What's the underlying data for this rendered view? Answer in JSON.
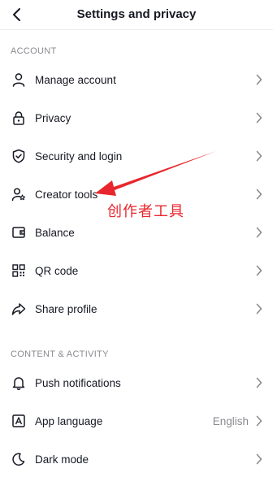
{
  "header": {
    "title": "Settings and privacy"
  },
  "sections": {
    "account": "ACCOUNT",
    "content": "CONTENT & ACTIVITY"
  },
  "items": {
    "manage_account": "Manage account",
    "privacy": "Privacy",
    "security": "Security and login",
    "creator_tools": "Creator tools",
    "balance": "Balance",
    "qr_code": "QR code",
    "share_profile": "Share profile",
    "push_notifications": "Push notifications",
    "app_language": "App language",
    "app_language_value": "English",
    "dark_mode": "Dark mode"
  },
  "annotation": {
    "text": "创作者工具",
    "color": "#e8262d"
  },
  "icons": {
    "back": "chevron-left-icon",
    "manage_account": "person-icon",
    "privacy": "lock-icon",
    "security": "shield-check-icon",
    "creator_tools": "person-star-icon",
    "balance": "wallet-icon",
    "qr_code": "qr-code-icon",
    "share_profile": "share-icon",
    "push_notifications": "bell-icon",
    "app_language": "letter-a-icon",
    "dark_mode": "moon-icon"
  }
}
